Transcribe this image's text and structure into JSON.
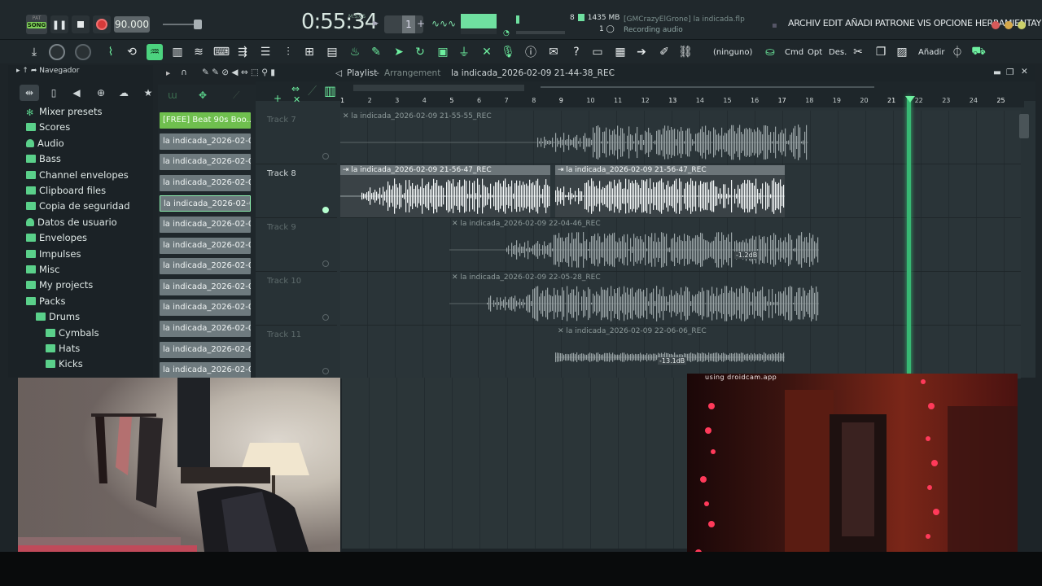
{
  "transport": {
    "pat_label": "PAT",
    "song_label": "SONG",
    "tempo": "90.000",
    "time": "0:55:34",
    "time_sub": "M:S:CS",
    "pattern_num": "1",
    "cpu_value": "8",
    "memory": "1435 MB",
    "poly": "1",
    "hint_project": "[GMCrazyElGrone] la indicada.flp",
    "hint_status": "Recording audio"
  },
  "menu": {
    "text": "ARCHIV EDIT AÑADI PATRONE VIS OPCIONE HERRAMIENTAY"
  },
  "toolbar2": {
    "ninguno": "(ninguno)",
    "cmd": "Cmd",
    "opt": "Opt",
    "des": "Des.",
    "anadir": "Añadir"
  },
  "browser": {
    "title": "Navegador",
    "items": [
      {
        "label": "Mixer presets",
        "icon": "star-icon"
      },
      {
        "label": "Scores",
        "icon": "folder-icon"
      },
      {
        "label": "Audio",
        "icon": "user-icon"
      },
      {
        "label": "Bass",
        "icon": "folder-icon"
      },
      {
        "label": "Channel envelopes",
        "icon": "folder-icon"
      },
      {
        "label": "Clipboard files",
        "icon": "folder-icon"
      },
      {
        "label": "Copia de seguridad",
        "icon": "folder-icon"
      },
      {
        "label": "Datos de usuario",
        "icon": "user-icon"
      },
      {
        "label": "Envelopes",
        "icon": "folder-icon"
      },
      {
        "label": "Impulses",
        "icon": "folder-icon"
      },
      {
        "label": "Misc",
        "icon": "folder-icon"
      },
      {
        "label": "My projects",
        "icon": "folder-icon"
      },
      {
        "label": "Packs",
        "icon": "folder-open-icon"
      },
      {
        "label": "Drums",
        "icon": "folder-open-icon"
      },
      {
        "label": "Cymbals",
        "icon": "folder-icon"
      },
      {
        "label": "Hats",
        "icon": "folder-icon"
      },
      {
        "label": "Kicks",
        "icon": "folder-icon"
      }
    ]
  },
  "channels": {
    "items": [
      "[FREE] Beat 90s Boo...",
      "la indicada_2026-02-09...",
      "la indicada_2026-02-09...",
      "la indicada_2026-02-09...",
      "la indicada_2026-02-09...",
      "la indicada_2026-02-09...",
      "la indicada_2026-02-09...",
      "la indicada_2026-02-09...",
      "la indicada_2026-02-09...",
      "la indicada_2026-02-09...",
      "la indicada_2026-02-09...",
      "la indicada_2026-02-09...",
      "la indicada_2026-02-09..."
    ]
  },
  "playlist": {
    "title": "Playlist",
    "subtitle": "Arrangement",
    "current_clip": "la indicada_2026-02-09 21-44-38_REC",
    "ruler": [
      "1",
      "2",
      "3",
      "4",
      "5",
      "6",
      "7",
      "8",
      "9",
      "10",
      "11",
      "12",
      "13",
      "14",
      "15",
      "16",
      "17",
      "18",
      "19",
      "20",
      "21",
      "22",
      "23",
      "24",
      "25"
    ],
    "tracks": [
      {
        "label": "Track 7",
        "clips": [
          {
            "name": "la indicada_2026-02-09 21-55-55_REC"
          }
        ]
      },
      {
        "label": "Track 8",
        "clips": [
          {
            "name": "la indicada_2026-02-09 21-56-47_REC"
          },
          {
            "name": "la indicada_2026-02-09 21-56-47_REC"
          }
        ]
      },
      {
        "label": "Track 9",
        "clips": [
          {
            "name": "la indicada_2026-02-09 22-04-46_REC",
            "gain": "-1.2dB"
          }
        ]
      },
      {
        "label": "Track 10",
        "clips": [
          {
            "name": "la indicada_2026-02-09 22-05-28_REC"
          }
        ]
      },
      {
        "label": "Track 11",
        "clips": [
          {
            "name": "la indicada_2026-02-09 22-06-06_REC",
            "gain": "-13.1dB"
          }
        ]
      }
    ]
  },
  "webcam": {
    "droidcam_label": "using droidcam.app"
  },
  "colors": {
    "accent": "#5ad08a",
    "record": "#d63a3a",
    "playhead": "#37b873"
  }
}
